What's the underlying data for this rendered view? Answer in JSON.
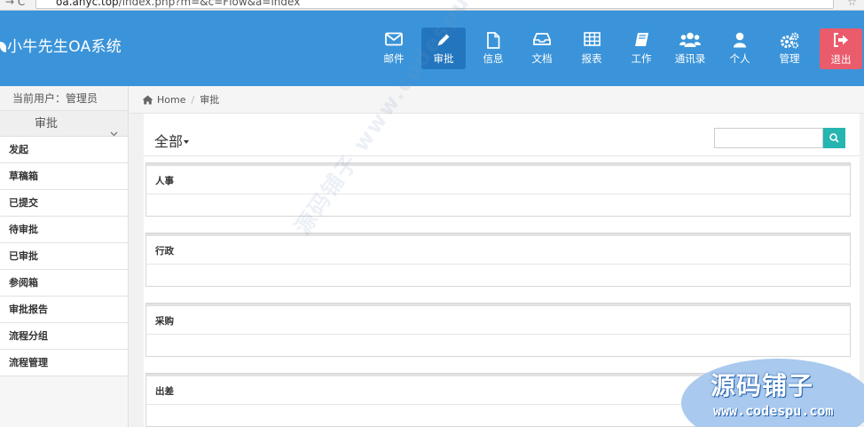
{
  "browser": {
    "url_host": "oa.anyc.top",
    "url_path": "/index.php?m=&c=Flow&a=index"
  },
  "brand": {
    "title": "小牛先生OA系统"
  },
  "nav": [
    {
      "label": "邮件",
      "icon": "envelope-icon"
    },
    {
      "label": "审批",
      "icon": "pencil-icon",
      "active": true
    },
    {
      "label": "信息",
      "icon": "file-icon"
    },
    {
      "label": "文档",
      "icon": "inbox-icon"
    },
    {
      "label": "报表",
      "icon": "table-icon"
    },
    {
      "label": "工作",
      "icon": "book-icon"
    },
    {
      "label": "通讯录",
      "icon": "users-icon"
    },
    {
      "label": "个人",
      "icon": "user-icon"
    },
    {
      "label": "管理",
      "icon": "cogs-icon"
    },
    {
      "label": "退出",
      "icon": "sign-out-icon"
    }
  ],
  "sidebar": {
    "current_user": "当前用户：管理员",
    "section": "审批",
    "items": [
      "发起",
      "草稿箱",
      "已提交",
      "待审批",
      "已审批",
      "参阅箱",
      "审批报告",
      "流程分组",
      "流程管理"
    ]
  },
  "breadcrumb": {
    "home": "Home",
    "current": "审批"
  },
  "main": {
    "filter_label": "全部",
    "search_placeholder": "",
    "panels": [
      "人事",
      "行政",
      "采购",
      "出差"
    ]
  },
  "watermark": {
    "text": "源码铺子 www.codespu.com",
    "badge_title": "源码铺子",
    "badge_url": "www.codespu.com"
  },
  "colors": {
    "header": "#3b94d9",
    "nav_active": "#2376be",
    "logout": "#ea5b6c",
    "search_button": "#26b5b0"
  }
}
